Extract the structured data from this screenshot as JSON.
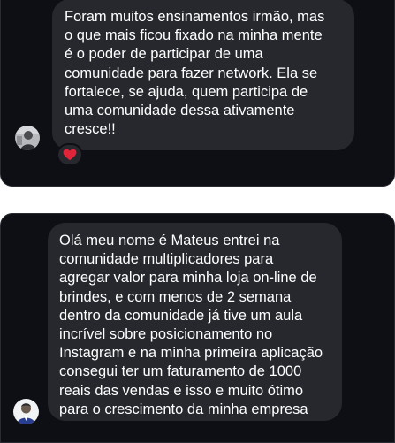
{
  "conversation_1": {
    "message": "Foram muitos ensinamentos irmão, mas\no que mais ficou fixado na minha mente\né o poder de participar de uma\ncomunidade para fazer network. Ela se\nfortalece, se ajuda, quem participa de\numa comunidade dessa ativamente\ncresce!!",
    "reaction_icon": "heart-icon",
    "avatar_icon": "user-avatar-icon"
  },
  "conversation_2": {
    "message": "Olá meu nome é Mateus entrei na\ncomunidade multiplicadores para\nagregar valor para minha loja on-line de\nbrindes, e com menos de 2 semana\ndentro da comunidade já tive um aula\nincrível sobre posicionamento no\nInstagram e na minha primeira aplicação\nconsegui ter um faturamento de 1000\nreais das vendas e isso e muito ótimo\npara o crescimento da minha empresa",
    "avatar_icon": "user-avatar-icon"
  },
  "colors": {
    "background": "#0e0f14",
    "bubble": "#26282e",
    "text": "#ffffff",
    "heart": "#e0243a"
  }
}
